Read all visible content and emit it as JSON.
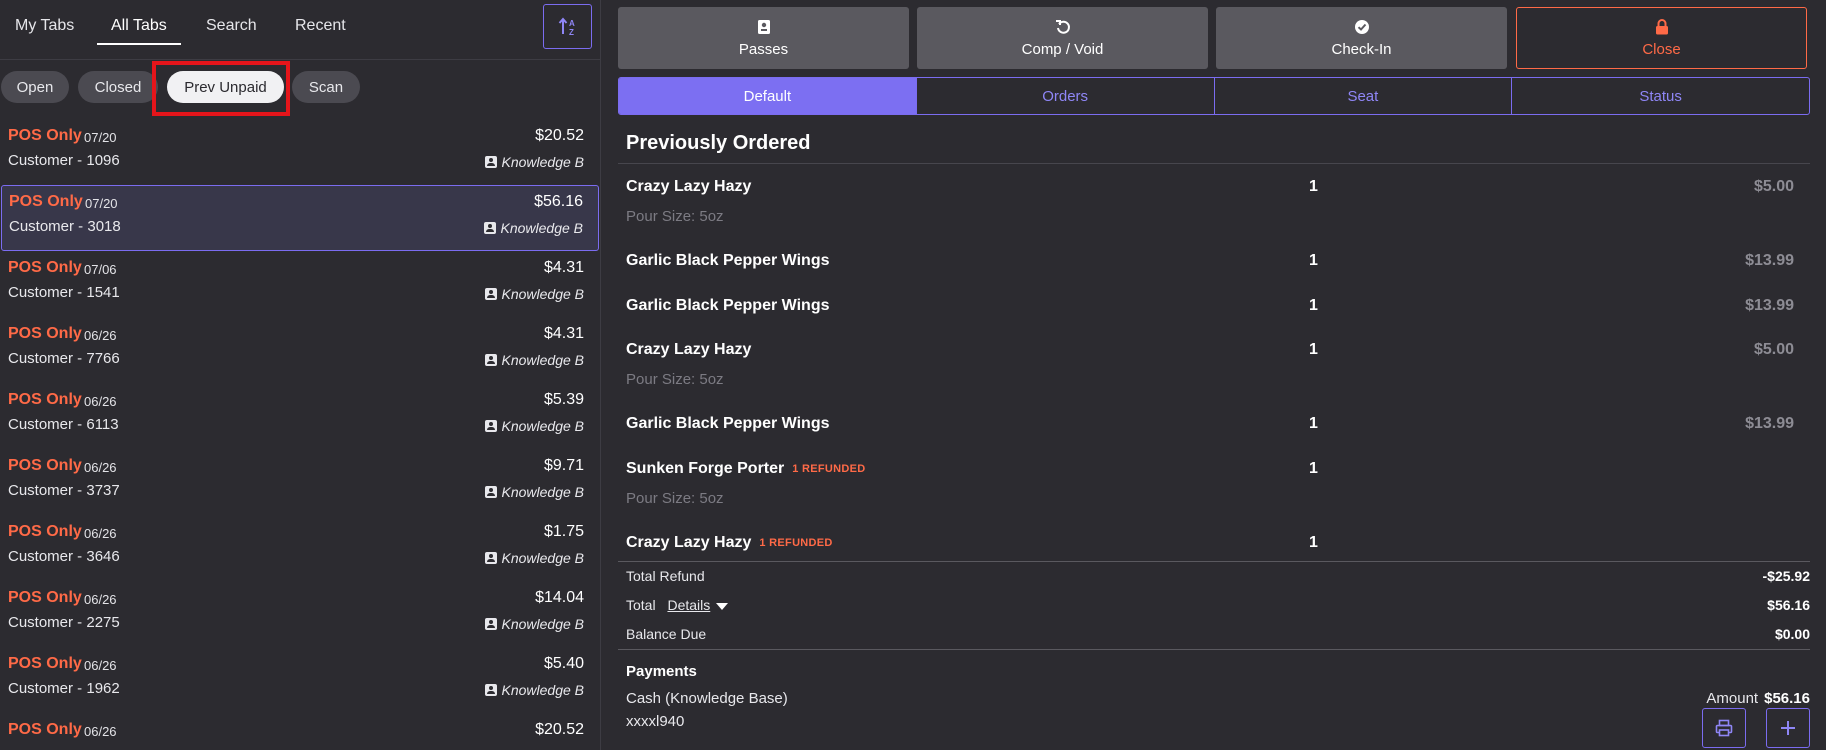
{
  "nav": {
    "tabs": [
      {
        "label": "My Tabs"
      },
      {
        "label": "All Tabs"
      },
      {
        "label": "Search"
      },
      {
        "label": "Recent"
      }
    ],
    "active_tab": "All Tabs",
    "sort_icon": "sort-icon"
  },
  "filters": [
    {
      "label": "Open"
    },
    {
      "label": "Closed"
    },
    {
      "label": "Prev Unpaid"
    },
    {
      "label": "Scan"
    }
  ],
  "active_filter": "Prev Unpaid",
  "tabs_list": [
    {
      "type": "POS Only",
      "date": "07/20",
      "amount": "$20.52",
      "customer": "Customer - 1096",
      "location": "Knowledge B"
    },
    {
      "type": "POS Only",
      "date": "07/20",
      "amount": "$56.16",
      "customer": "Customer - 3018",
      "location": "Knowledge B"
    },
    {
      "type": "POS Only",
      "date": "07/06",
      "amount": "$4.31",
      "customer": "Customer - 1541",
      "location": "Knowledge B"
    },
    {
      "type": "POS Only",
      "date": "06/26",
      "amount": "$4.31",
      "customer": "Customer - 7766",
      "location": "Knowledge B"
    },
    {
      "type": "POS Only",
      "date": "06/26",
      "amount": "$5.39",
      "customer": "Customer - 6113",
      "location": "Knowledge B"
    },
    {
      "type": "POS Only",
      "date": "06/26",
      "amount": "$9.71",
      "customer": "Customer - 3737",
      "location": "Knowledge B"
    },
    {
      "type": "POS Only",
      "date": "06/26",
      "amount": "$1.75",
      "customer": "Customer - 3646",
      "location": "Knowledge B"
    },
    {
      "type": "POS Only",
      "date": "06/26",
      "amount": "$14.04",
      "customer": "Customer - 2275",
      "location": "Knowledge B"
    },
    {
      "type": "POS Only",
      "date": "06/26",
      "amount": "$5.40",
      "customer": "Customer - 1962",
      "location": "Knowledge B"
    },
    {
      "type": "POS Only",
      "date": "06/26",
      "amount": "$20.52",
      "customer": "",
      "location": ""
    }
  ],
  "selected_index": 1,
  "actions": [
    {
      "label": "Passes",
      "icon": "pass-icon"
    },
    {
      "label": "Comp / Void",
      "icon": "undo-icon"
    },
    {
      "label": "Check-In",
      "icon": "check-circle-icon"
    },
    {
      "label": "Close",
      "icon": "lock-icon"
    }
  ],
  "segments": [
    {
      "label": "Default"
    },
    {
      "label": "Orders"
    },
    {
      "label": "Seat"
    },
    {
      "label": "Status"
    }
  ],
  "active_segment": "Default",
  "order": {
    "title": "Previously Ordered",
    "items": [
      {
        "name": "Crazy Lazy Hazy",
        "qty": "1",
        "price": "$5.00",
        "sub": "Pour Size: 5oz",
        "refund": ""
      },
      {
        "name": "Garlic Black Pepper Wings",
        "qty": "1",
        "price": "$13.99",
        "sub": "",
        "refund": ""
      },
      {
        "name": "Garlic Black Pepper Wings",
        "qty": "1",
        "price": "$13.99",
        "sub": "",
        "refund": ""
      },
      {
        "name": "Crazy Lazy Hazy",
        "qty": "1",
        "price": "$5.00",
        "sub": "Pour Size: 5oz",
        "refund": ""
      },
      {
        "name": "Garlic Black Pepper Wings",
        "qty": "1",
        "price": "$13.99",
        "sub": "",
        "refund": ""
      },
      {
        "name": "Sunken Forge Porter",
        "qty": "1",
        "price": "",
        "sub": "Pour Size: 5oz",
        "refund": "1 REFUNDED"
      },
      {
        "name": "Crazy Lazy Hazy",
        "qty": "1",
        "price": "",
        "sub": "",
        "refund": "1 REFUNDED"
      }
    ]
  },
  "totals": {
    "refund_label": "Total Refund",
    "refund_value": "-$25.92",
    "total_label": "Total",
    "details_label": "Details",
    "total_value": "$56.16",
    "balance_label": "Balance Due",
    "balance_value": "$0.00"
  },
  "payments": {
    "title": "Payments",
    "method": "Cash (Knowledge Base)",
    "card": "xxxxl940",
    "amount_label": "Amount",
    "amount_value": "$56.16"
  },
  "colors": {
    "accent": "#7b6cf0",
    "warning": "#ff6a47",
    "background": "#2c2b30"
  }
}
